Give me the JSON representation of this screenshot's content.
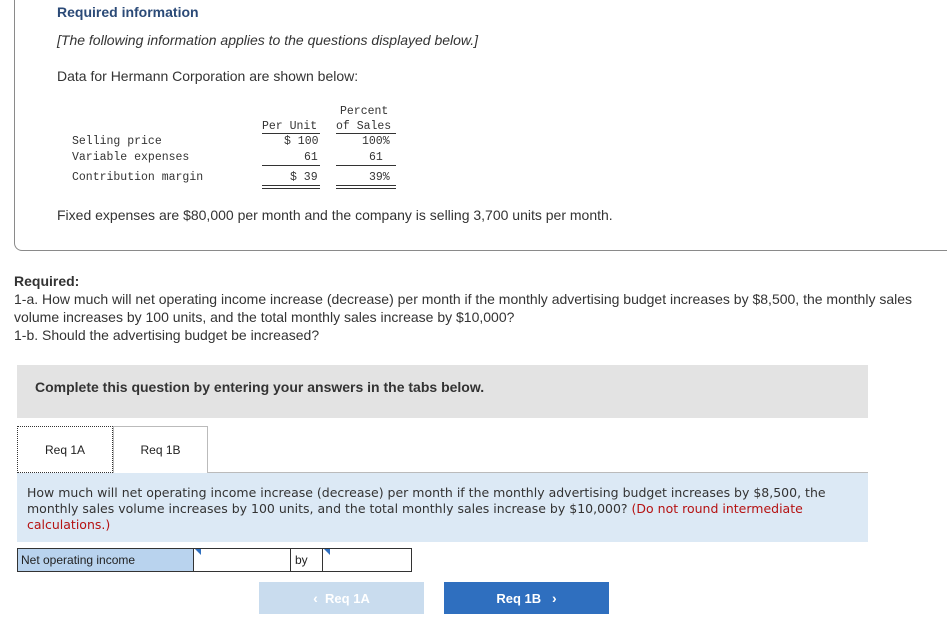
{
  "info": {
    "title": "Required information",
    "subtitle": "[The following information applies to the questions displayed below.]",
    "intro": "Data for Hermann Corporation are shown below:",
    "table": {
      "header_percent_top": "Percent",
      "header_per_unit": "Per Unit",
      "header_percent_bottom": "of Sales",
      "rows": [
        {
          "label": "Selling price",
          "per_unit": "$ 100",
          "percent": "100%"
        },
        {
          "label": "Variable expenses",
          "per_unit": "61",
          "percent": "61"
        },
        {
          "label": "Contribution margin",
          "per_unit": "$ 39",
          "percent": "39%"
        }
      ]
    },
    "fixed_expenses": "Fixed expenses are $80,000 per month and the company is selling 3,700 units per month."
  },
  "required": {
    "heading": "Required:",
    "q1a": "1-a. How much will net operating income increase (decrease) per month if the monthly advertising budget increases by $8,500, the monthly sales volume increases by 100 units, and the total monthly sales increase by $10,000?",
    "q1b": "1-b. Should the advertising budget be increased?"
  },
  "instruction": "Complete this question by entering your answers in the tabs below.",
  "tabs": [
    "Req 1A",
    "Req 1B"
  ],
  "question": {
    "text": "How much will net operating income increase (decrease) per month if the monthly advertising budget increases by $8,500, the monthly sales volume increases by 100 units, and the total monthly sales increase by $10,000?",
    "note": "(Do not round intermediate calculations.)"
  },
  "answer": {
    "label": "Net operating income",
    "value": "",
    "by_label": "by",
    "amount": ""
  },
  "nav": {
    "prev_label": "Req 1A",
    "next_label": "Req 1B",
    "prev_icon": "‹",
    "next_icon": "›"
  }
}
